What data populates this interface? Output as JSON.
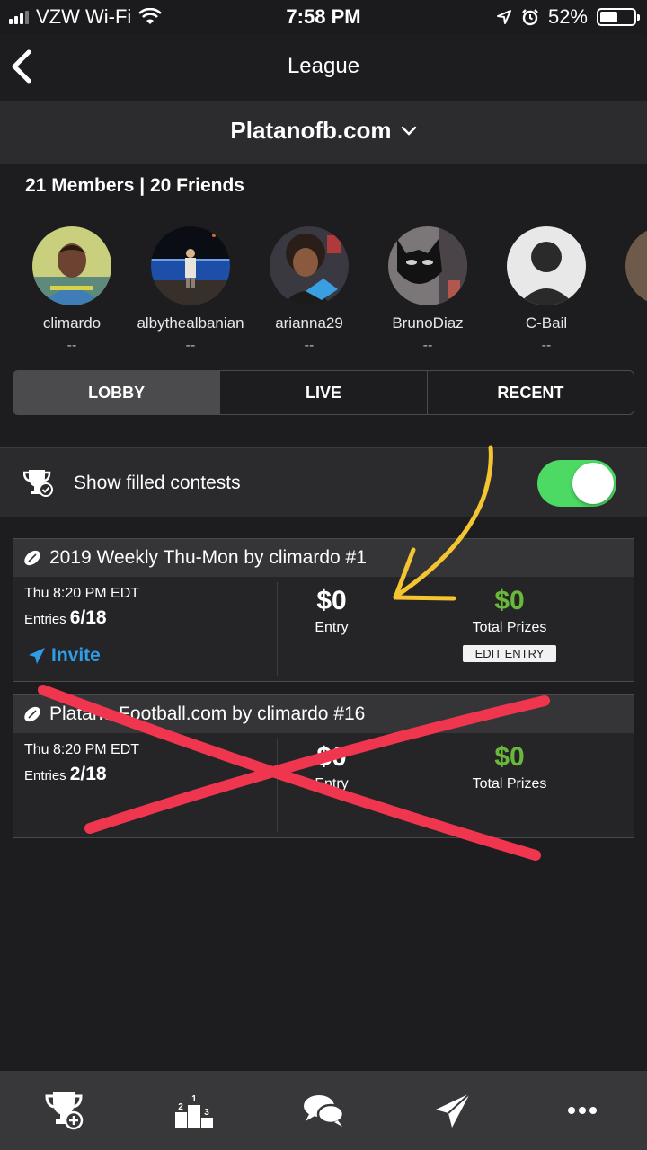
{
  "status_bar": {
    "carrier": "VZW Wi-Fi",
    "time": "7:58 PM",
    "battery": "52%",
    "battery_level": 0.52
  },
  "nav": {
    "title": "League",
    "back_icon": "chevron-left-icon"
  },
  "league": {
    "name": "Platanofb.com",
    "dropdown_icon": "chevron-down-icon"
  },
  "members_summary": "21 Members | 20 Friends",
  "friends": [
    {
      "name": "climardo",
      "score": "--"
    },
    {
      "name": "albythealbanian",
      "score": "--"
    },
    {
      "name": "arianna29",
      "score": "--"
    },
    {
      "name": "BrunoDiaz",
      "score": "--"
    },
    {
      "name": "C-Bail",
      "score": "--"
    }
  ],
  "tabs": [
    "LOBBY",
    "LIVE",
    "RECENT"
  ],
  "active_tab": "LOBBY",
  "filled_contests": {
    "label": "Show filled contests",
    "enabled": true
  },
  "contests": [
    {
      "title": "2019 Weekly Thu-Mon by climardo #1",
      "time": "Thu 8:20 PM EDT",
      "entries_label": "Entries",
      "entries": "6/18",
      "invite": "Invite",
      "entry_fee": "$0",
      "entry_label": "Entry",
      "prizes": "$0",
      "prizes_label": "Total Prizes",
      "edit_label": "EDIT ENTRY"
    },
    {
      "title": "Platano Football.com by climardo #16",
      "time": "Thu 8:20 PM EDT",
      "entries_label": "Entries",
      "entries": "2/18",
      "entry_fee": "$0",
      "entry_label": "Entry",
      "prizes": "$0",
      "prizes_label": "Total Prizes"
    }
  ],
  "bottom_tabs": [
    "trophy-plus-icon",
    "podium-icon",
    "chat-bubbles-icon",
    "send-icon",
    "more-icon"
  ],
  "colors": {
    "background": "#1d1d1f",
    "toggle_on": "#4cd964",
    "prize_green": "#6ab83a",
    "invite_blue": "#2f9ee6",
    "arrow_yellow": "#f5c531",
    "cross_red": "#f0364f"
  }
}
